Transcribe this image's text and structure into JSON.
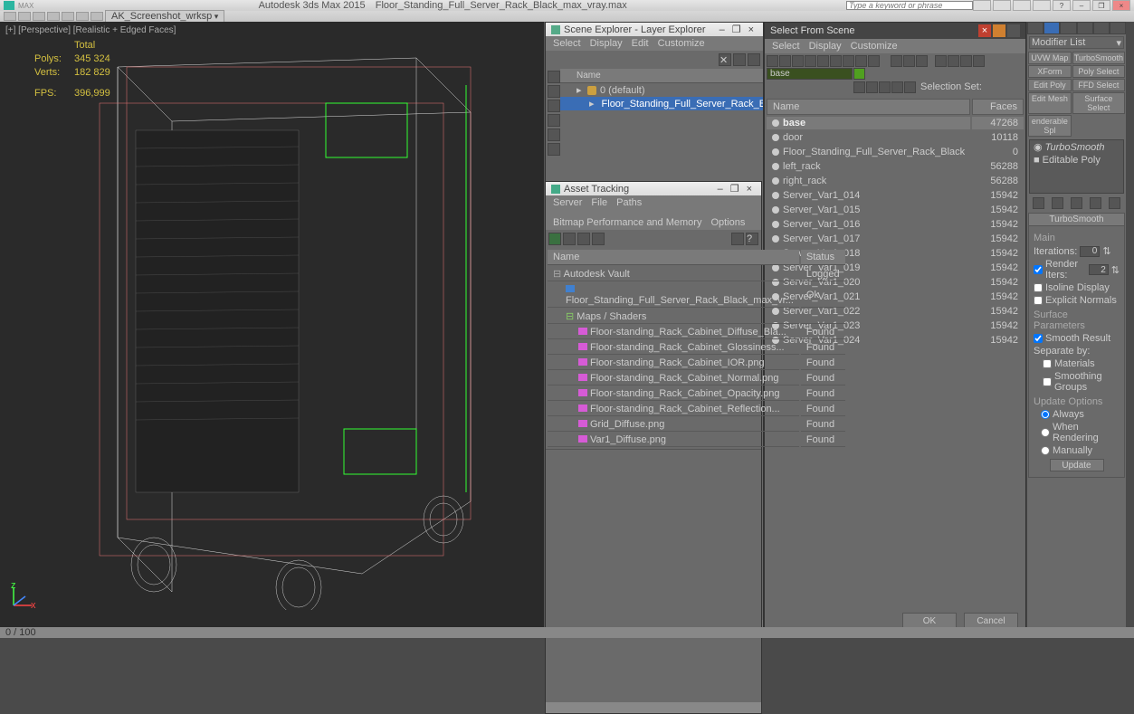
{
  "app": {
    "title_left": "Autodesk 3ds Max 2015",
    "title_file": "Floor_Standing_Full_Server_Rack_Black_max_vray.max",
    "tab_name": "AK_Screenshot_wrksp",
    "search_placeholder": "Type a keyword or phrase"
  },
  "viewport": {
    "label": "[+] [Perspective] [Realistic + Edged Faces]",
    "stats": {
      "total_label": "Total",
      "polys_label": "Polys:",
      "polys": "345 324",
      "verts_label": "Verts:",
      "verts": "182 829",
      "fps_label": "FPS:",
      "fps": "396,999"
    },
    "status": "0 / 100"
  },
  "scene_explorer": {
    "title": "Scene Explorer - Layer Explorer",
    "menus": [
      "Select",
      "Display",
      "Edit",
      "Customize"
    ],
    "name_col": "Name",
    "items": [
      {
        "label": "0 (default)",
        "indent": 1,
        "selected": false
      },
      {
        "label": "Floor_Standing_Full_Server_Rack_Black",
        "indent": 2,
        "selected": true
      }
    ],
    "layer_label": "Layer Explorer",
    "selset_label": "Selection Set:"
  },
  "asset_tracking": {
    "title": "Asset Tracking",
    "menus": [
      "Server",
      "File",
      "Paths",
      "Bitmap Performance and Memory",
      "Options"
    ],
    "cols": [
      "Name",
      "Status"
    ],
    "rows": [
      {
        "name": "Autodesk Vault",
        "status": "Logged",
        "icon": "vault",
        "indent": 0
      },
      {
        "name": "Floor_Standing_Full_Server_Rack_Black_max_vr...",
        "status": "Ok",
        "icon": "max",
        "indent": 1
      },
      {
        "name": "Maps / Shaders",
        "status": "",
        "icon": "cat",
        "indent": 1
      },
      {
        "name": "Floor-standing_Rack_Cabinet_Diffuse_Bla...",
        "status": "Found",
        "icon": "img",
        "indent": 2
      },
      {
        "name": "Floor-standing_Rack_Cabinet_Glossiness...",
        "status": "Found",
        "icon": "img",
        "indent": 2
      },
      {
        "name": "Floor-standing_Rack_Cabinet_IOR.png",
        "status": "Found",
        "icon": "img",
        "indent": 2
      },
      {
        "name": "Floor-standing_Rack_Cabinet_Normal.png",
        "status": "Found",
        "icon": "img",
        "indent": 2
      },
      {
        "name": "Floor-standing_Rack_Cabinet_Opacity.png",
        "status": "Found",
        "icon": "img",
        "indent": 2
      },
      {
        "name": "Floor-standing_Rack_Cabinet_Reflection...",
        "status": "Found",
        "icon": "img",
        "indent": 2
      },
      {
        "name": "Grid_Diffuse.png",
        "status": "Found",
        "icon": "img",
        "indent": 2
      },
      {
        "name": "Var1_Diffuse.png",
        "status": "Found",
        "icon": "img",
        "indent": 2
      }
    ]
  },
  "select_from_scene": {
    "title": "Select From Scene",
    "menus": [
      "Select",
      "Display",
      "Customize"
    ],
    "selset_label": "Selection Set:",
    "search_value": "base",
    "cols": [
      "Name",
      "Faces"
    ],
    "rows": [
      {
        "name": "base",
        "faces": "47268",
        "sel": true
      },
      {
        "name": "door",
        "faces": "10118",
        "sel": false
      },
      {
        "name": "Floor_Standing_Full_Server_Rack_Black",
        "faces": "0",
        "sel": false
      },
      {
        "name": "left_rack",
        "faces": "56288",
        "sel": false
      },
      {
        "name": "right_rack",
        "faces": "56288",
        "sel": false
      },
      {
        "name": "Server_Var1_014",
        "faces": "15942",
        "sel": false
      },
      {
        "name": "Server_Var1_015",
        "faces": "15942",
        "sel": false
      },
      {
        "name": "Server_Var1_016",
        "faces": "15942",
        "sel": false
      },
      {
        "name": "Server_Var1_017",
        "faces": "15942",
        "sel": false
      },
      {
        "name": "Server_Var1_018",
        "faces": "15942",
        "sel": false
      },
      {
        "name": "Server_Var1_019",
        "faces": "15942",
        "sel": false
      },
      {
        "name": "Server_Var1_020",
        "faces": "15942",
        "sel": false
      },
      {
        "name": "Server_Var1_021",
        "faces": "15942",
        "sel": false
      },
      {
        "name": "Server_Var1_022",
        "faces": "15942",
        "sel": false
      },
      {
        "name": "Server_Var1_023",
        "faces": "15942",
        "sel": false
      },
      {
        "name": "Server_Var1_024",
        "faces": "15942",
        "sel": false
      }
    ],
    "ok": "OK",
    "cancel": "Cancel"
  },
  "modifier_panel": {
    "list_label": "Modifier List",
    "buttons": [
      "UVW Map",
      "TurboSmooth",
      "XForm",
      "Poly Select",
      "Edit Poly",
      "FFD Select",
      "Edit Mesh",
      "Surface Select",
      "enderable Spl"
    ],
    "stack": [
      {
        "label": "TurboSmooth",
        "icon": "bulb"
      },
      {
        "label": "Editable Poly",
        "icon": "box"
      }
    ],
    "rollout": {
      "title": "TurboSmooth",
      "main_label": "Main",
      "iterations_label": "Iterations:",
      "iterations_value": "0",
      "render_iters_label": "Render Iters:",
      "render_iters_value": "2",
      "isoline": "Isoline Display",
      "explicit_normals": "Explicit Normals",
      "surface_params": "Surface Parameters",
      "smooth_result": "Smooth Result",
      "separate": "Separate by:",
      "materials": "Materials",
      "smoothing_groups": "Smoothing Groups",
      "update_options": "Update Options",
      "always": "Always",
      "when_rendering": "When Rendering",
      "manually": "Manually",
      "update": "Update"
    }
  }
}
